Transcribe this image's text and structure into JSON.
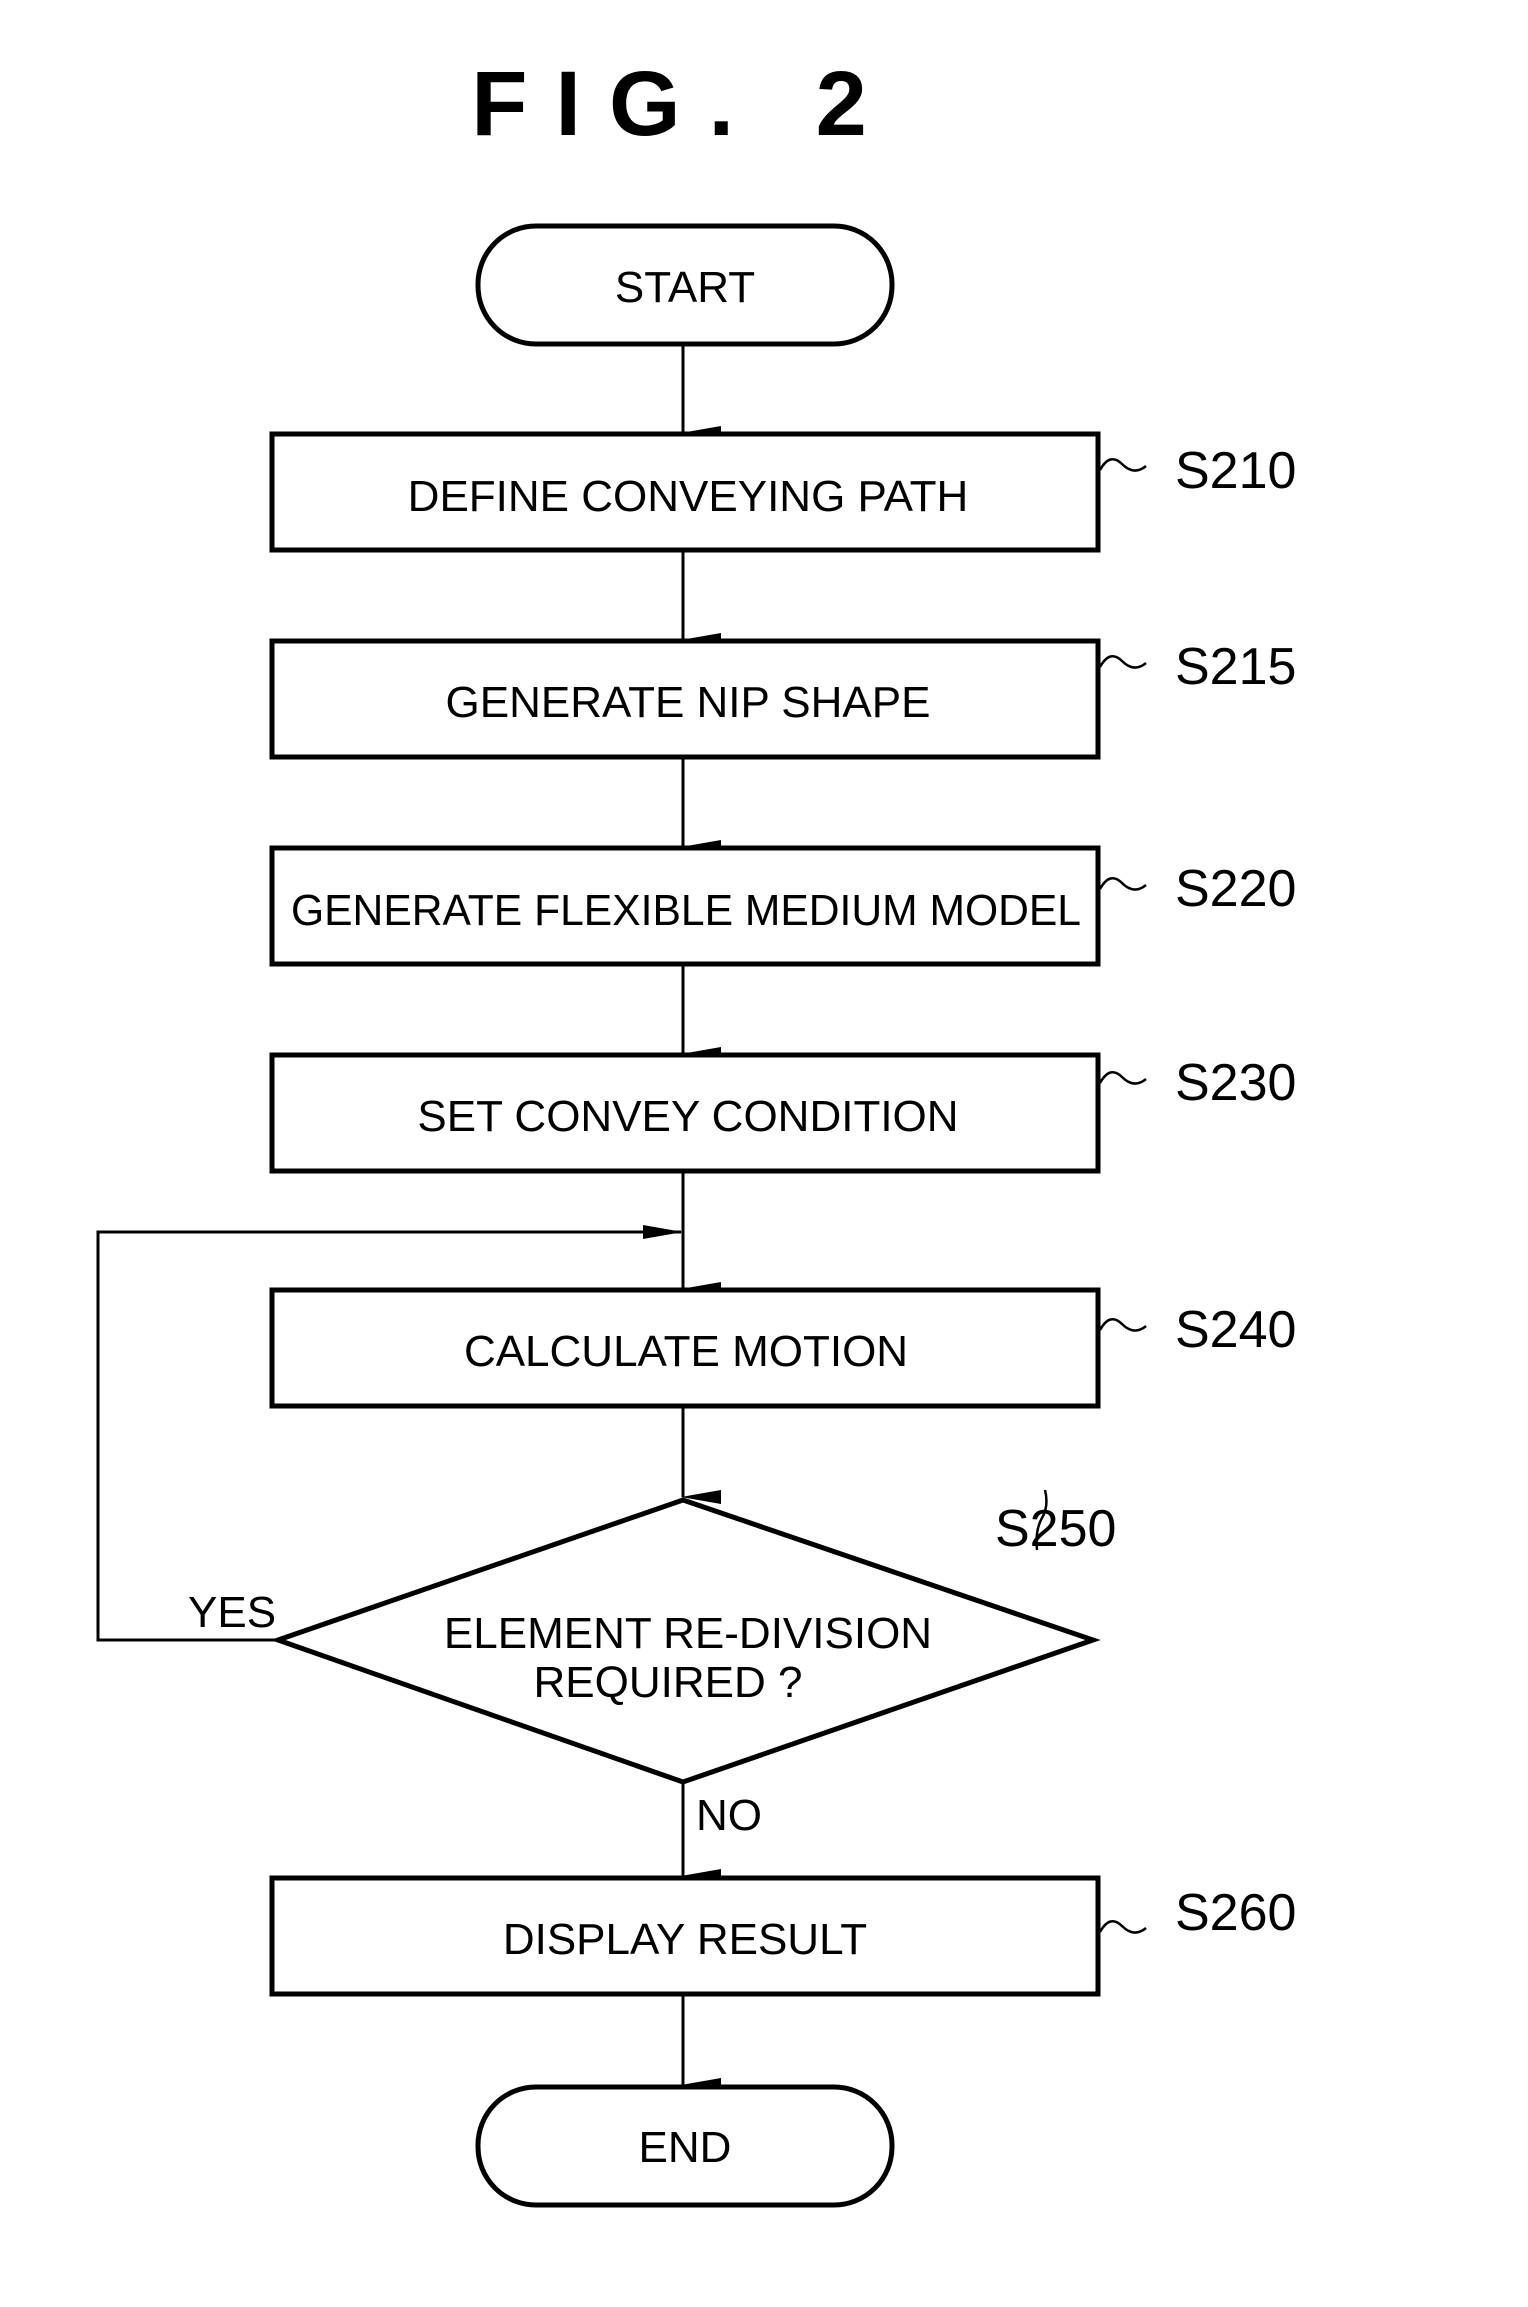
{
  "figure": {
    "title": "FIG. 2"
  },
  "flowchart": {
    "start": {
      "label": "START"
    },
    "steps": [
      {
        "id": "S210",
        "label": "DEFINE CONVEYING PATH"
      },
      {
        "id": "S215",
        "label": "GENERATE NIP SHAPE"
      },
      {
        "id": "S220",
        "label": "GENERATE FLEXIBLE MEDIUM MODEL"
      },
      {
        "id": "S230",
        "label": "SET CONVEY CONDITION"
      },
      {
        "id": "S240",
        "label": "CALCULATE MOTION"
      }
    ],
    "decision": {
      "id": "S250",
      "line1": "ELEMENT RE-DIVISION",
      "line2": "REQUIRED ?",
      "yes_label": "YES",
      "no_label": "NO"
    },
    "result_step": {
      "id": "S260",
      "label": "DISPLAY RESULT"
    },
    "end": {
      "label": "END"
    }
  }
}
